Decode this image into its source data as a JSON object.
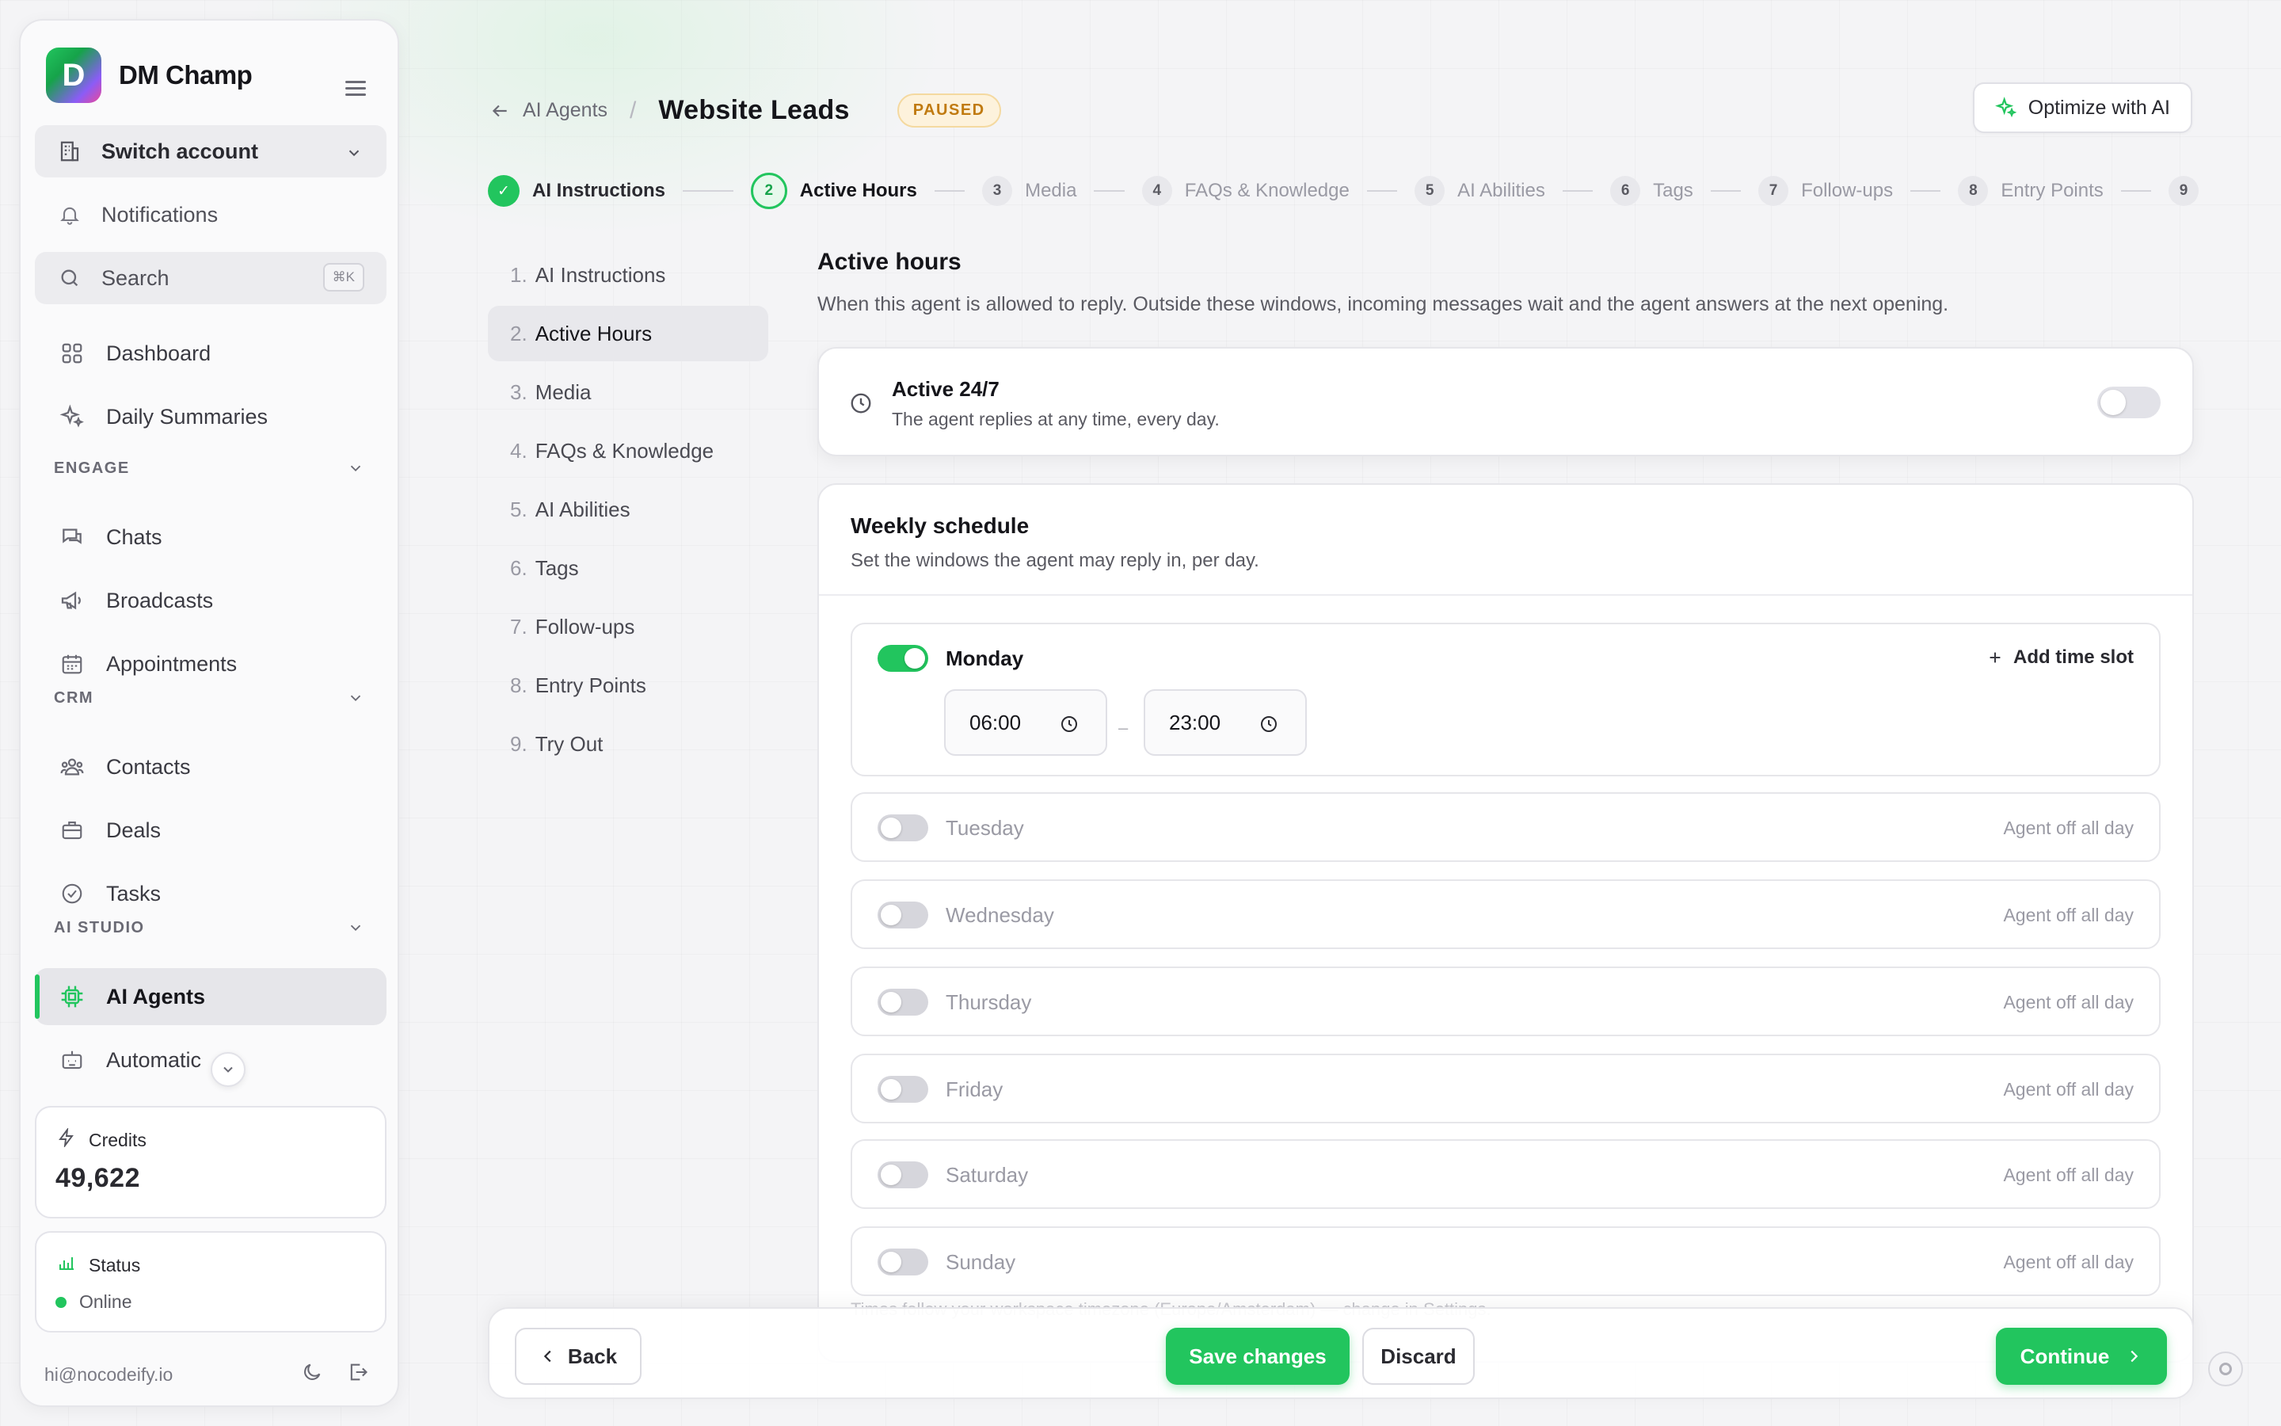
{
  "brand": {
    "name": "DM Champ",
    "logo_letter": "D"
  },
  "sidebar": {
    "switch_account": "Switch account",
    "notifications": "Notifications",
    "search": {
      "label": "Search",
      "shortcut": "⌘K"
    },
    "top_items": [
      {
        "label": "Dashboard",
        "icon": "grid-icon"
      },
      {
        "label": "Daily Summaries",
        "icon": "sparkle-icon"
      }
    ],
    "sections": {
      "engage": {
        "label": "ENGAGE",
        "items": [
          "Chats",
          "Broadcasts",
          "Appointments"
        ]
      },
      "crm": {
        "label": "CRM",
        "items": [
          "Contacts",
          "Deals",
          "Tasks"
        ]
      },
      "ai_studio": {
        "label": "AI STUDIO",
        "items": [
          "AI Agents",
          "Automatic"
        ]
      }
    },
    "active_item": "AI Agents",
    "credits": {
      "label": "Credits",
      "value": "49,622"
    },
    "status": {
      "label": "Status",
      "value": "Online"
    },
    "email": "hi@nocodeify.io"
  },
  "header": {
    "back_label": "AI Agents",
    "separator": "/",
    "title": "Website Leads",
    "badge": "PAUSED",
    "optimize_label": "Optimize with AI"
  },
  "stepper": {
    "steps": [
      {
        "num": "✓",
        "label": "AI Instructions",
        "state": "done"
      },
      {
        "num": "2",
        "label": "Active Hours",
        "state": "current"
      },
      {
        "num": "3",
        "label": "Media",
        "state": "todo"
      },
      {
        "num": "4",
        "label": "FAQs & Knowledge",
        "state": "todo"
      },
      {
        "num": "5",
        "label": "AI Abilities",
        "state": "todo"
      },
      {
        "num": "6",
        "label": "Tags",
        "state": "todo"
      },
      {
        "num": "7",
        "label": "Follow-ups",
        "state": "todo"
      },
      {
        "num": "8",
        "label": "Entry Points",
        "state": "todo"
      },
      {
        "num": "9",
        "label": "",
        "state": "todo"
      }
    ]
  },
  "sublist": {
    "items": [
      {
        "num": "1.",
        "label": "AI Instructions"
      },
      {
        "num": "2.",
        "label": "Active Hours"
      },
      {
        "num": "3.",
        "label": "Media"
      },
      {
        "num": "4.",
        "label": "FAQs & Knowledge"
      },
      {
        "num": "5.",
        "label": "AI Abilities"
      },
      {
        "num": "6.",
        "label": "Tags"
      },
      {
        "num": "7.",
        "label": "Follow-ups"
      },
      {
        "num": "8.",
        "label": "Entry Points"
      },
      {
        "num": "9.",
        "label": "Try Out"
      }
    ],
    "active_index": 1
  },
  "content": {
    "title": "Active hours",
    "description": "When this agent is allowed to reply. Outside these windows, incoming messages wait and the agent answers at the next opening.",
    "always_on": {
      "title": "Active 24/7",
      "subtitle": "The agent replies at any time, every day.",
      "enabled": false
    },
    "weekly": {
      "title": "Weekly schedule",
      "subtitle": "Set the windows the agent may reply in, per day.",
      "add_slot_label": "Add time slot",
      "off_label": "Agent off all day",
      "time_separator": "–",
      "days": [
        {
          "name": "Monday",
          "enabled": true,
          "start": "06:00",
          "end": "23:00"
        },
        {
          "name": "Tuesday",
          "enabled": false
        },
        {
          "name": "Wednesday",
          "enabled": false
        },
        {
          "name": "Thursday",
          "enabled": false
        },
        {
          "name": "Friday",
          "enabled": false
        },
        {
          "name": "Saturday",
          "enabled": false
        },
        {
          "name": "Sunday",
          "enabled": false
        }
      ],
      "timezone_note": "Times follow your workspace timezone (Europe/Amsterdam) — change in Settings."
    }
  },
  "actions": {
    "back": "Back",
    "save": "Save changes",
    "discard": "Discard",
    "continue": "Continue"
  },
  "colors": {
    "accent": "#22c55e",
    "badge_bg": "#fdf2dc",
    "badge_text": "#c07a10"
  }
}
